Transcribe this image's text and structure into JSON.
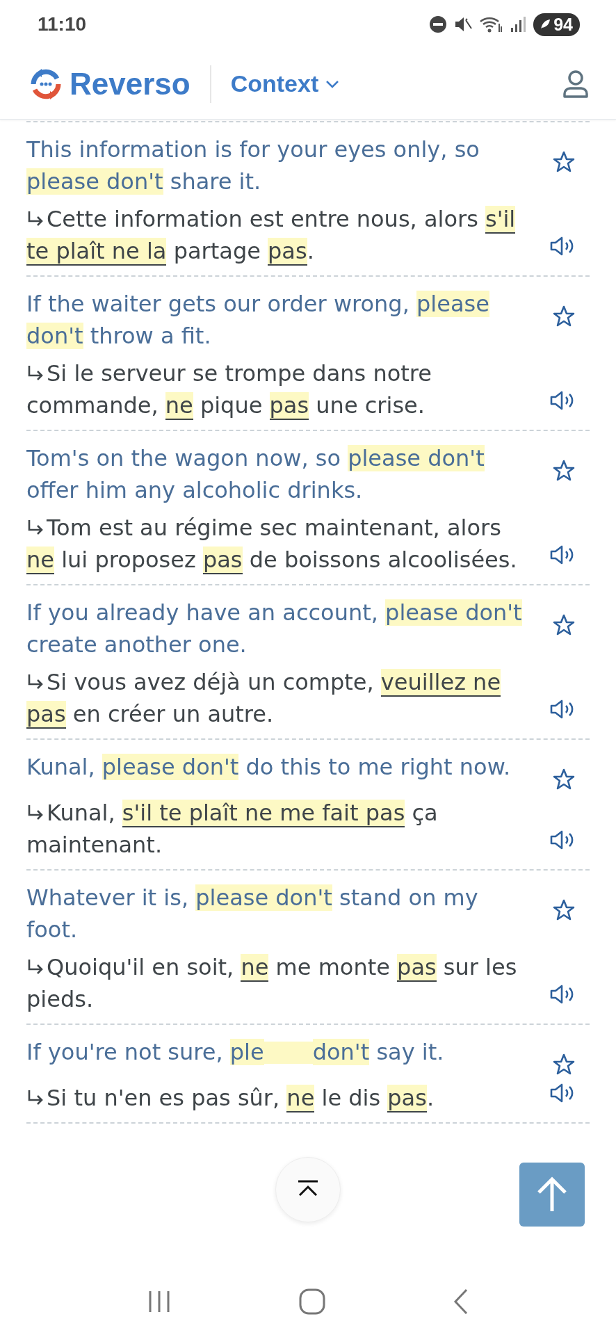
{
  "status_bar": {
    "time": "11:10",
    "battery": "94"
  },
  "header": {
    "logo_text": "Reverso",
    "mode": "Context"
  },
  "examples": [
    {
      "source": [
        {
          "text": "This information is for your eyes only, so "
        },
        {
          "text": "please don't",
          "highlight": true
        },
        {
          "text": " share it."
        }
      ],
      "target": [
        {
          "text": "Cette information est entre nous, alors "
        },
        {
          "text": "s'il te plaît ne la",
          "highlight": true
        },
        {
          "text": " partage "
        },
        {
          "text": "pas",
          "highlight": true
        },
        {
          "text": "."
        }
      ]
    },
    {
      "source": [
        {
          "text": "If the waiter gets our order wrong, "
        },
        {
          "text": "please don't",
          "highlight": true
        },
        {
          "text": " throw a fit."
        }
      ],
      "target": [
        {
          "text": "Si le serveur se trompe dans notre commande, "
        },
        {
          "text": "ne",
          "highlight": true
        },
        {
          "text": " pique "
        },
        {
          "text": "pas",
          "highlight": true
        },
        {
          "text": " une crise."
        }
      ]
    },
    {
      "source": [
        {
          "text": "Tom's on the wagon now, so "
        },
        {
          "text": "please don't",
          "highlight": true
        },
        {
          "text": " offer him any alcoholic drinks."
        }
      ],
      "target": [
        {
          "text": "Tom est au régime sec maintenant, alors "
        },
        {
          "text": "ne",
          "highlight": true
        },
        {
          "text": " lui proposez "
        },
        {
          "text": "pas",
          "highlight": true
        },
        {
          "text": " de boissons alcoolisées."
        }
      ]
    },
    {
      "source": [
        {
          "text": "If you already have an account, "
        },
        {
          "text": "please don't",
          "highlight": true
        },
        {
          "text": " create another one."
        }
      ],
      "target": [
        {
          "text": "Si vous avez déjà un compte, "
        },
        {
          "text": "veuillez ne pas",
          "highlight": true
        },
        {
          "text": " en créer un autre."
        }
      ]
    },
    {
      "source": [
        {
          "text": "Kunal, "
        },
        {
          "text": "please don't",
          "highlight": true
        },
        {
          "text": " do this to me right now."
        }
      ],
      "target": [
        {
          "text": "Kunal, "
        },
        {
          "text": "s'il te plaît ne me fait pas",
          "highlight": true
        },
        {
          "text": " ça maintenant."
        }
      ]
    },
    {
      "source": [
        {
          "text": "Whatever it is, "
        },
        {
          "text": "please don't",
          "highlight": true
        },
        {
          "text": " stand on my foot."
        }
      ],
      "target": [
        {
          "text": "Quoiqu'il en soit, "
        },
        {
          "text": "ne",
          "highlight": true
        },
        {
          "text": " me monte "
        },
        {
          "text": "pas",
          "highlight": true
        },
        {
          "text": " sur les pieds."
        }
      ]
    },
    {
      "source": [
        {
          "text": "If you're not sure, "
        },
        {
          "text": "ple",
          "highlight": true
        },
        {
          "kind": "covered",
          "highlight": true
        },
        {
          "text": "don't",
          "highlight": true
        },
        {
          "text": " say it."
        }
      ],
      "target": [
        {
          "text": "Si tu n'en es pas sûr, "
        },
        {
          "text": "ne",
          "highlight": true
        },
        {
          "text": " le dis "
        },
        {
          "text": "pas",
          "highlight": true
        },
        {
          "text": "."
        }
      ]
    }
  ]
}
